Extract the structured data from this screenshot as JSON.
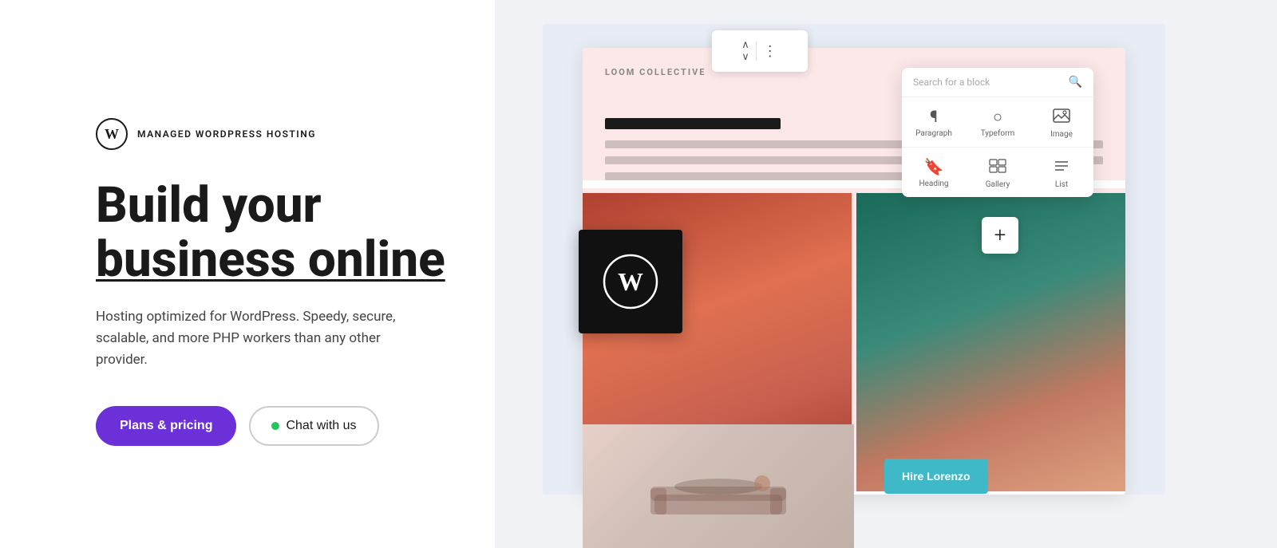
{
  "brand": {
    "label": "MANAGED WORDPRESS HOSTING"
  },
  "hero": {
    "headline_line1": "Build your",
    "headline_line2": "business online",
    "subheadline": "Hosting optimized for WordPress. Speedy, secure, scalable, and more PHP workers than any other provider.",
    "cta_primary": "Plans & pricing",
    "cta_chat": "Chat with us"
  },
  "block_picker": {
    "search_placeholder": "Search for a block",
    "blocks": [
      {
        "label": "Paragraph",
        "icon": "¶"
      },
      {
        "label": "Typeform",
        "icon": "○"
      },
      {
        "label": "Image",
        "icon": "🖼"
      },
      {
        "label": "Heading",
        "icon": "🔖"
      },
      {
        "label": "Gallery",
        "icon": "⊟"
      },
      {
        "label": "List",
        "icon": "≡"
      }
    ]
  },
  "card": {
    "site_name": "LOOM COLLECTIVE"
  },
  "hire_btn": {
    "label": "Hire Lorenzo"
  }
}
